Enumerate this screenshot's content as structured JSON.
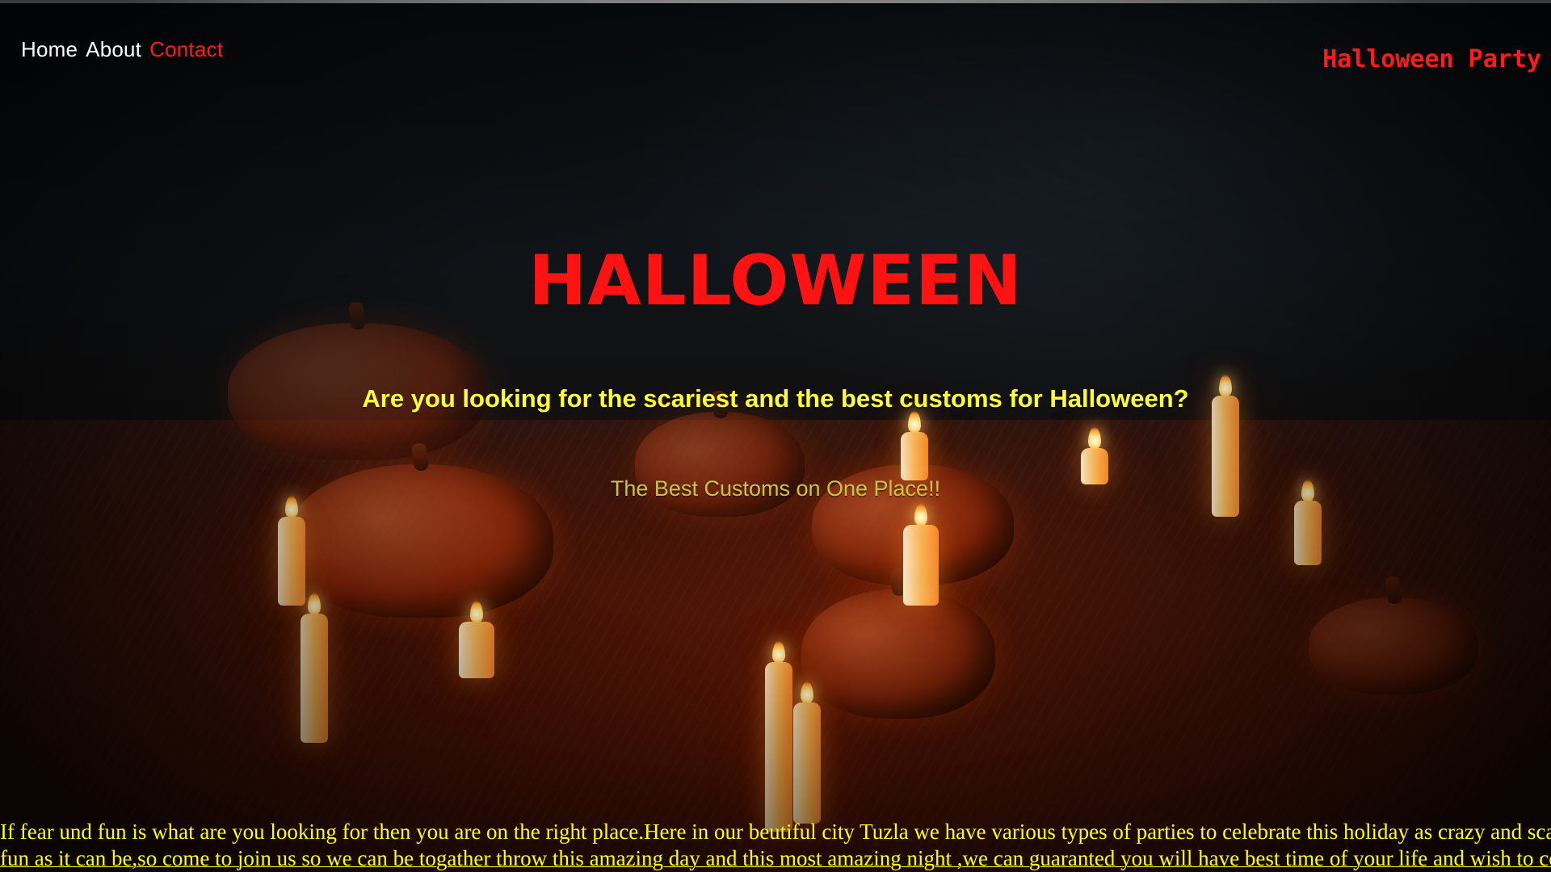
{
  "nav": {
    "items": [
      {
        "label": "Home",
        "active": false
      },
      {
        "label": "About",
        "active": false
      },
      {
        "label": "Contact",
        "active": true
      }
    ]
  },
  "brand": {
    "title": "Halloween Party"
  },
  "hero": {
    "title": "HALLOWEEN",
    "question": "Are you looking for the scariest and the best customs for Halloween?",
    "subtitle": "The Best Customs on One Place!!"
  },
  "footer_text": {
    "line1": "If fear und fun is what are you looking for then you are on the right place.Here in our beutiful city Tuzla we have various types of parties to celebrate this holiday as crazy and scariest and as",
    "line2": "fun as it can be,so come to join us so we can be togather throw this amazing day and this most amazing night ,we can guaranted you will have best time of your life and wish to come back"
  },
  "colors": {
    "accent_red": "#ff1212",
    "nav_text": "#ffffff",
    "question_yellow": "#ffff33",
    "subtitle_olive": "#c8c44a",
    "paragraph_yellow": "#ffff00"
  }
}
